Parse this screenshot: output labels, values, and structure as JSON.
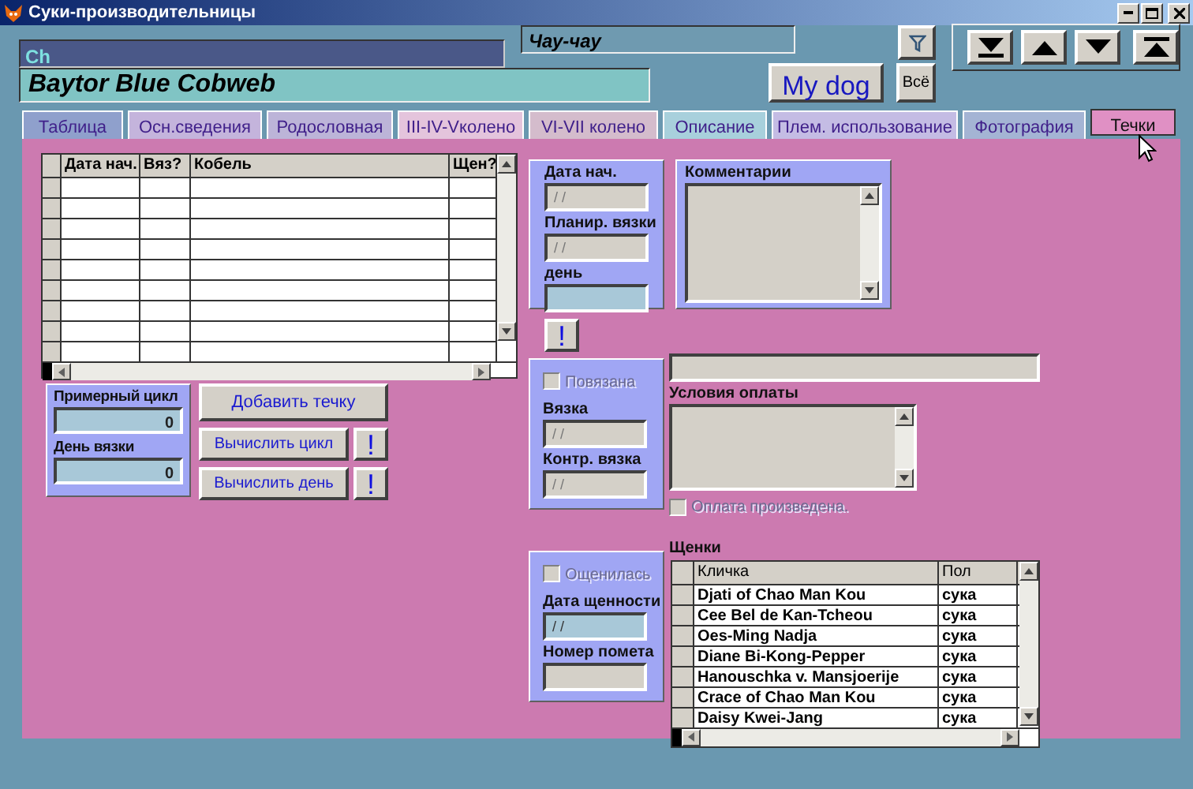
{
  "window": {
    "title": "Суки-производительницы"
  },
  "header": {
    "prefix": "Ch",
    "dog_name": "Baytor Blue Cobweb",
    "breed": "Чау-чау",
    "my_dog_button": "My dog",
    "all_button": "Всё"
  },
  "tabs": [
    {
      "label": "Таблица",
      "selected": false,
      "color": "#8fa0cc"
    },
    {
      "label": "Осн.сведения",
      "selected": false,
      "color": "#c4b4dc"
    },
    {
      "label": "Родословная",
      "selected": false,
      "color": "#bcb4d8"
    },
    {
      "label": "III-IV-Vколено",
      "selected": false,
      "color": "#e4c4dc"
    },
    {
      "label": "VI-VII колено",
      "selected": false,
      "color": "#d4bccc"
    },
    {
      "label": "Описание",
      "selected": false,
      "color": "#a8d0dc"
    },
    {
      "label": "Плем. использование",
      "selected": false,
      "color": "#c4bce4"
    },
    {
      "label": "Фотография",
      "selected": false,
      "color": "#a4b4d4"
    },
    {
      "label": "Течки",
      "selected": true,
      "color": "#e090c4"
    }
  ],
  "heats_table": {
    "columns": [
      "Дата нач.",
      "Вяз?",
      "Кобель",
      "Щен?"
    ]
  },
  "cycle_panel": {
    "fields": [
      {
        "label": "Примерный цикл",
        "value": "0"
      },
      {
        "label": "День вязки",
        "value": "0"
      }
    ]
  },
  "actions": {
    "add_button": "Добавить течку",
    "calc_cycle_button": "Вычислить цикл",
    "calc_day_button": "Вычислить день",
    "info_mark": "!"
  },
  "heat_panel": {
    "fields": [
      {
        "label": "Дата нач.",
        "value": "/ /",
        "disabled": true
      },
      {
        "label": "Планир. вязки",
        "value": "/ /",
        "disabled": true
      },
      {
        "label": "день",
        "disabled": false
      }
    ]
  },
  "comments": {
    "label": "Комментарии"
  },
  "mid_button": "!",
  "mating_panel": {
    "checkbox": {
      "label": "Повязана",
      "checked": false,
      "disabled": true
    },
    "fields": [
      {
        "label": "Вязка",
        "value": "/ /",
        "disabled": true
      },
      {
        "label": "Контр. вязка",
        "value": "/ /",
        "disabled": true
      }
    ]
  },
  "payment": {
    "label": "Условия оплаты",
    "checkbox": {
      "label": "Оплата произведена.",
      "checked": false,
      "disabled": true
    }
  },
  "whelping_panel": {
    "checkbox": {
      "label": "Ощенилась",
      "checked": false,
      "disabled": true
    },
    "fields": [
      {
        "label": "Дата щенности",
        "value": "/ /",
        "disabled": false
      },
      {
        "label": "Номер помета",
        "disabled": true
      }
    ]
  },
  "puppies": {
    "label": "Щенки",
    "columns": [
      "Кличка",
      "Пол"
    ],
    "rows": [
      {
        "name": "Djati of Chao Man Kou",
        "sex": "сука"
      },
      {
        "name": "Cee Bel de Kan-Tcheou",
        "sex": "сука"
      },
      {
        "name": "Oes-Ming Nadja",
        "sex": "сука"
      },
      {
        "name": "Diane Bi-Kong-Pepper",
        "sex": "сука"
      },
      {
        "name": "Hanouschka v. Mansjoerije",
        "sex": "сука"
      },
      {
        "name": "Crace of Chao Man Kou",
        "sex": "сука"
      },
      {
        "name": "Daisy Kwei-Jang",
        "sex": "сука"
      }
    ]
  }
}
